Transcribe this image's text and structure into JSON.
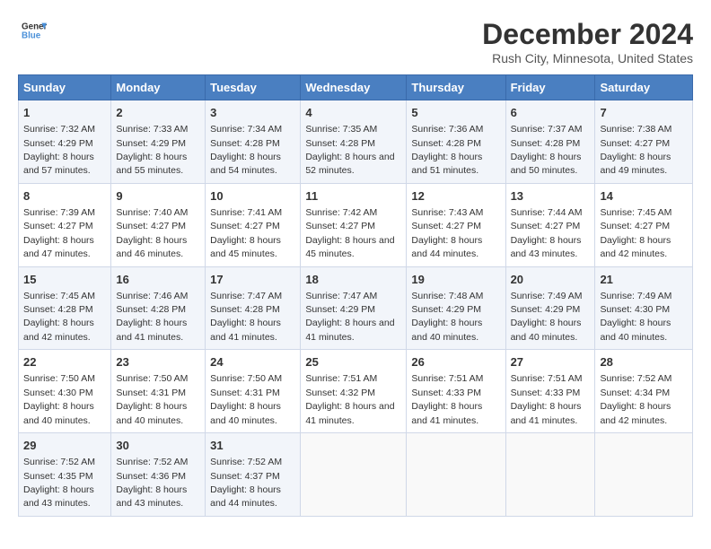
{
  "header": {
    "logo_line1": "General",
    "logo_line2": "Blue",
    "month": "December 2024",
    "location": "Rush City, Minnesota, United States"
  },
  "days_of_week": [
    "Sunday",
    "Monday",
    "Tuesday",
    "Wednesday",
    "Thursday",
    "Friday",
    "Saturday"
  ],
  "weeks": [
    [
      {
        "day": "1",
        "sunrise": "7:32 AM",
        "sunset": "4:29 PM",
        "daylight": "8 hours and 57 minutes."
      },
      {
        "day": "2",
        "sunrise": "7:33 AM",
        "sunset": "4:29 PM",
        "daylight": "8 hours and 55 minutes."
      },
      {
        "day": "3",
        "sunrise": "7:34 AM",
        "sunset": "4:28 PM",
        "daylight": "8 hours and 54 minutes."
      },
      {
        "day": "4",
        "sunrise": "7:35 AM",
        "sunset": "4:28 PM",
        "daylight": "8 hours and 52 minutes."
      },
      {
        "day": "5",
        "sunrise": "7:36 AM",
        "sunset": "4:28 PM",
        "daylight": "8 hours and 51 minutes."
      },
      {
        "day": "6",
        "sunrise": "7:37 AM",
        "sunset": "4:28 PM",
        "daylight": "8 hours and 50 minutes."
      },
      {
        "day": "7",
        "sunrise": "7:38 AM",
        "sunset": "4:27 PM",
        "daylight": "8 hours and 49 minutes."
      }
    ],
    [
      {
        "day": "8",
        "sunrise": "7:39 AM",
        "sunset": "4:27 PM",
        "daylight": "8 hours and 47 minutes."
      },
      {
        "day": "9",
        "sunrise": "7:40 AM",
        "sunset": "4:27 PM",
        "daylight": "8 hours and 46 minutes."
      },
      {
        "day": "10",
        "sunrise": "7:41 AM",
        "sunset": "4:27 PM",
        "daylight": "8 hours and 45 minutes."
      },
      {
        "day": "11",
        "sunrise": "7:42 AM",
        "sunset": "4:27 PM",
        "daylight": "8 hours and 45 minutes."
      },
      {
        "day": "12",
        "sunrise": "7:43 AM",
        "sunset": "4:27 PM",
        "daylight": "8 hours and 44 minutes."
      },
      {
        "day": "13",
        "sunrise": "7:44 AM",
        "sunset": "4:27 PM",
        "daylight": "8 hours and 43 minutes."
      },
      {
        "day": "14",
        "sunrise": "7:45 AM",
        "sunset": "4:27 PM",
        "daylight": "8 hours and 42 minutes."
      }
    ],
    [
      {
        "day": "15",
        "sunrise": "7:45 AM",
        "sunset": "4:28 PM",
        "daylight": "8 hours and 42 minutes."
      },
      {
        "day": "16",
        "sunrise": "7:46 AM",
        "sunset": "4:28 PM",
        "daylight": "8 hours and 41 minutes."
      },
      {
        "day": "17",
        "sunrise": "7:47 AM",
        "sunset": "4:28 PM",
        "daylight": "8 hours and 41 minutes."
      },
      {
        "day": "18",
        "sunrise": "7:47 AM",
        "sunset": "4:29 PM",
        "daylight": "8 hours and 41 minutes."
      },
      {
        "day": "19",
        "sunrise": "7:48 AM",
        "sunset": "4:29 PM",
        "daylight": "8 hours and 40 minutes."
      },
      {
        "day": "20",
        "sunrise": "7:49 AM",
        "sunset": "4:29 PM",
        "daylight": "8 hours and 40 minutes."
      },
      {
        "day": "21",
        "sunrise": "7:49 AM",
        "sunset": "4:30 PM",
        "daylight": "8 hours and 40 minutes."
      }
    ],
    [
      {
        "day": "22",
        "sunrise": "7:50 AM",
        "sunset": "4:30 PM",
        "daylight": "8 hours and 40 minutes."
      },
      {
        "day": "23",
        "sunrise": "7:50 AM",
        "sunset": "4:31 PM",
        "daylight": "8 hours and 40 minutes."
      },
      {
        "day": "24",
        "sunrise": "7:50 AM",
        "sunset": "4:31 PM",
        "daylight": "8 hours and 40 minutes."
      },
      {
        "day": "25",
        "sunrise": "7:51 AM",
        "sunset": "4:32 PM",
        "daylight": "8 hours and 41 minutes."
      },
      {
        "day": "26",
        "sunrise": "7:51 AM",
        "sunset": "4:33 PM",
        "daylight": "8 hours and 41 minutes."
      },
      {
        "day": "27",
        "sunrise": "7:51 AM",
        "sunset": "4:33 PM",
        "daylight": "8 hours and 41 minutes."
      },
      {
        "day": "28",
        "sunrise": "7:52 AM",
        "sunset": "4:34 PM",
        "daylight": "8 hours and 42 minutes."
      }
    ],
    [
      {
        "day": "29",
        "sunrise": "7:52 AM",
        "sunset": "4:35 PM",
        "daylight": "8 hours and 43 minutes."
      },
      {
        "day": "30",
        "sunrise": "7:52 AM",
        "sunset": "4:36 PM",
        "daylight": "8 hours and 43 minutes."
      },
      {
        "day": "31",
        "sunrise": "7:52 AM",
        "sunset": "4:37 PM",
        "daylight": "8 hours and 44 minutes."
      },
      null,
      null,
      null,
      null
    ]
  ],
  "labels": {
    "sunrise": "Sunrise:",
    "sunset": "Sunset:",
    "daylight": "Daylight:"
  }
}
